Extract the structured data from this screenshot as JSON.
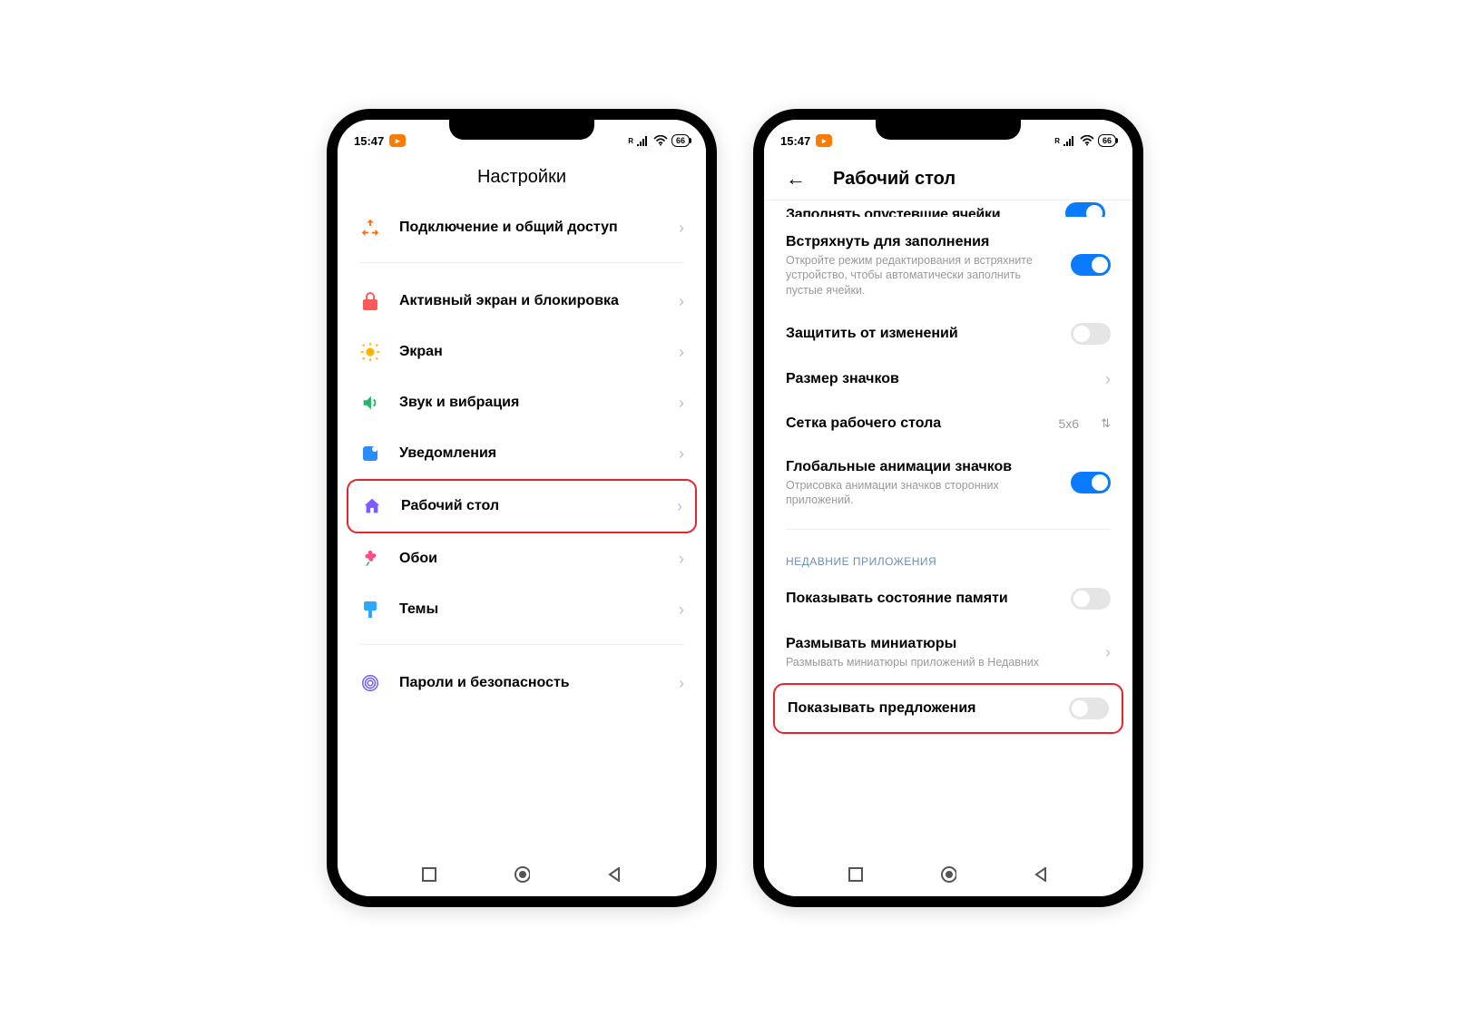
{
  "status": {
    "time": "15:47",
    "signal_label": "R",
    "battery": "66"
  },
  "left": {
    "title": "Настройки",
    "items": [
      {
        "title": "Подключение и общий доступ",
        "icon": "share",
        "color": "#ff6a00"
      },
      {
        "title": "Активный экран и блокировка",
        "icon": "lock",
        "color": "#ff5a5a"
      },
      {
        "title": "Экран",
        "icon": "sun",
        "color": "#ffb400"
      },
      {
        "title": "Звук и вибрация",
        "icon": "sound",
        "color": "#1fb866"
      },
      {
        "title": "Уведомления",
        "icon": "notif",
        "color": "#2a8cff"
      },
      {
        "title": "Рабочий стол",
        "icon": "home",
        "color": "#7a5cff"
      },
      {
        "title": "Обои",
        "icon": "flower",
        "color": "#ff4d88"
      },
      {
        "title": "Темы",
        "icon": "brush",
        "color": "#2aa9ff"
      },
      {
        "title": "Пароли и безопасность",
        "icon": "fingerprint",
        "color": "#6a5cff"
      }
    ]
  },
  "right": {
    "title": "Рабочий стол",
    "partial_top": "Заполнять опустевшие ячейки",
    "items": [
      {
        "title": "Встряхнуть для заполнения",
        "sub": "Откройте режим редактирования и встряхните устройство, чтобы автоматически заполнить пустые ячейки.",
        "control": "toggle",
        "on": true
      },
      {
        "title": "Защитить от изменений",
        "control": "toggle",
        "on": false
      },
      {
        "title": "Размер значков",
        "control": "chevron"
      },
      {
        "title": "Сетка рабочего стола",
        "control": "value",
        "value": "5x6"
      },
      {
        "title": "Глобальные анимации значков",
        "sub": "Отрисовка анимации значков сторонних приложений.",
        "control": "toggle",
        "on": true
      }
    ],
    "section": "НЕДАВНИЕ ПРИЛОЖЕНИЯ",
    "section_items": [
      {
        "title": "Показывать состояние памяти",
        "control": "toggle",
        "on": false
      },
      {
        "title": "Размывать миниатюры",
        "sub": "Размывать миниатюры приложений в Недавних",
        "control": "chevron"
      },
      {
        "title": "Показывать предложения",
        "control": "toggle",
        "on": false
      }
    ]
  }
}
